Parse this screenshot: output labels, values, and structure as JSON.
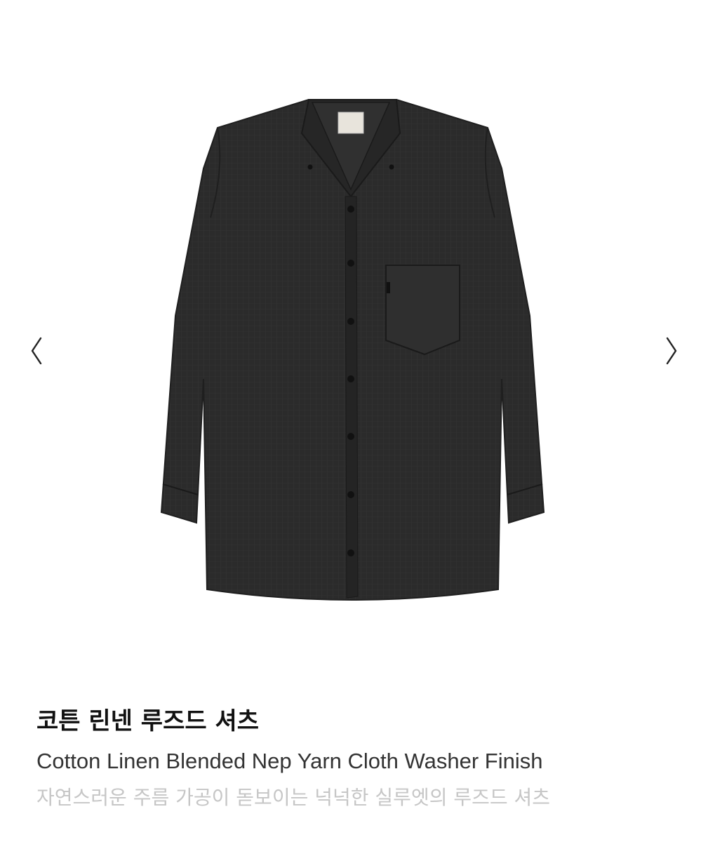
{
  "product": {
    "title_ko": "코튼 린넨 루즈드 셔츠",
    "title_en": "Cotton Linen Blended Nep Yarn Cloth Washer Finish",
    "description_ko": "자연스러운 주름 가공이 돋보이는 넉넉한 실루엣의 루즈드 셔츠"
  },
  "gallery": {
    "image_subject": "shirt-image",
    "prev_icon": "chevron-left-icon",
    "next_icon": "chevron-right-icon"
  },
  "colors": {
    "shirt": "#2b2b2b",
    "shirt_shadow": "#1f1f1f",
    "title": "#111111",
    "subtitle": "#333333",
    "description": "#c6c6c6",
    "arrow": "#222222"
  }
}
